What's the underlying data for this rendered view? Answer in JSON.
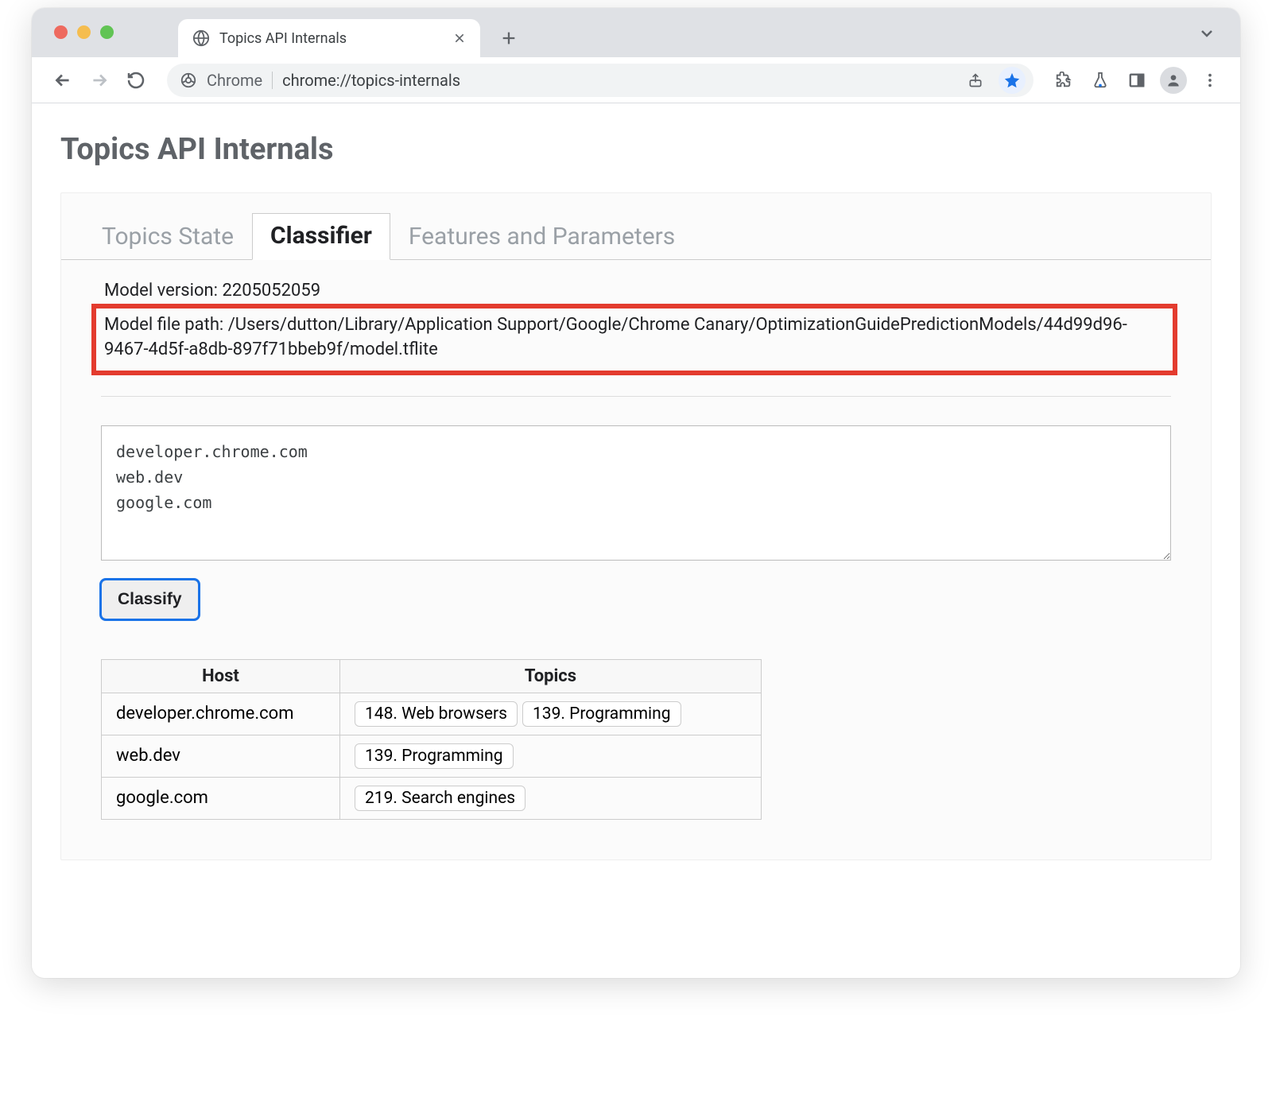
{
  "window": {
    "tab_title": "Topics API Internals"
  },
  "omnibox": {
    "scheme_label": "Chrome",
    "url": "chrome://topics-internals"
  },
  "page": {
    "title": "Topics API Internals"
  },
  "tabs": {
    "topics_state": "Topics State",
    "classifier": "Classifier",
    "features": "Features and Parameters",
    "active": "classifier"
  },
  "classifier": {
    "model_version_label": "Model version:",
    "model_version": "2205052059",
    "model_file_path_label": "Model file path:",
    "model_file_path": "/Users/dutton/Library/Application Support/Google/Chrome Canary/OptimizationGuidePredictionModels/44d99d96-9467-4d5f-a8db-897f71bbeb9f/model.tflite",
    "hosts_input": "developer.chrome.com\nweb.dev\ngoogle.com",
    "classify_button": "Classify",
    "table": {
      "headers": {
        "host": "Host",
        "topics": "Topics"
      },
      "rows": [
        {
          "host": "developer.chrome.com",
          "topics": [
            "148. Web browsers",
            "139. Programming"
          ]
        },
        {
          "host": "web.dev",
          "topics": [
            "139. Programming"
          ]
        },
        {
          "host": "google.com",
          "topics": [
            "219. Search engines"
          ]
        }
      ]
    }
  }
}
